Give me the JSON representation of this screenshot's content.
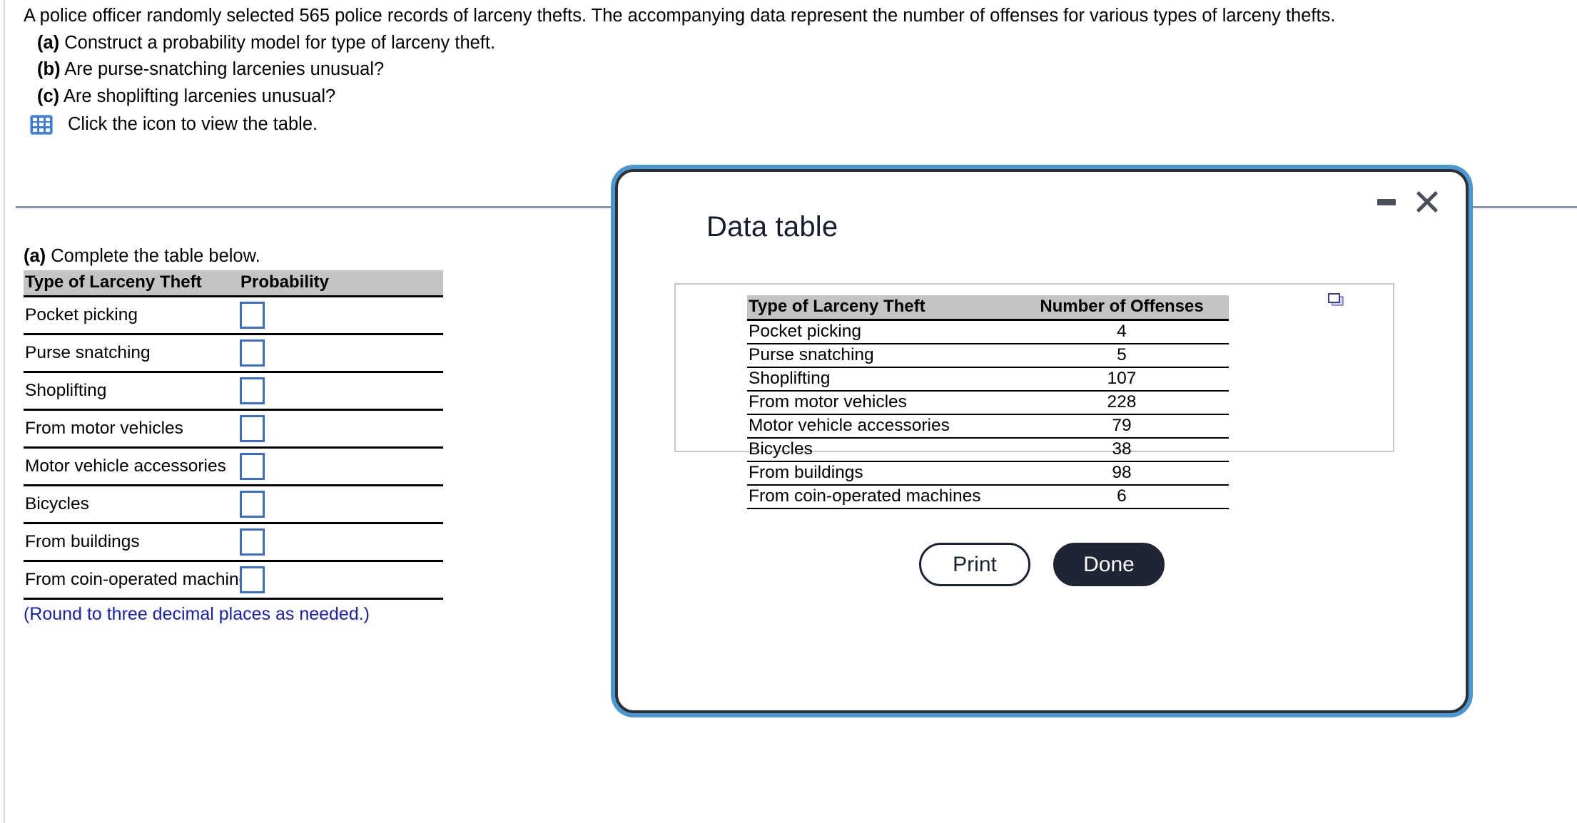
{
  "problem": {
    "intro": "A police officer randomly selected 565 police records of larceny thefts. The accompanying data represent the number of offenses for various types of larceny thefts.",
    "parts": [
      {
        "label": "(a)",
        "text": "Construct a probability model for type of larceny theft."
      },
      {
        "label": "(b)",
        "text": "Are purse-snatching larcenies unusual?"
      },
      {
        "label": "(c)",
        "text": "Are shoplifting larcenies unusual?"
      }
    ],
    "icon_line": {
      "icon": "table-grid-icon",
      "text": "Click the icon to view the table."
    }
  },
  "answer_section": {
    "heading_label": "(a)",
    "heading_text": "Complete the table below.",
    "columns": [
      "Type of Larceny Theft",
      "Probability"
    ],
    "rows": [
      {
        "type": "Pocket picking",
        "probability": ""
      },
      {
        "type": "Purse snatching",
        "probability": ""
      },
      {
        "type": "Shoplifting",
        "probability": ""
      },
      {
        "type": "From motor vehicles",
        "probability": ""
      },
      {
        "type": "Motor vehicle accessories",
        "probability": ""
      },
      {
        "type": "Bicycles",
        "probability": ""
      },
      {
        "type": "From buildings",
        "probability": ""
      },
      {
        "type": "From coin-operated machines",
        "probability": ""
      }
    ],
    "round_note": "(Round to three decimal places as needed.)",
    "input_border_color": "#3b6fc4",
    "header_bg_color": "#c4c4c4",
    "note_color": "#1a21b0"
  },
  "dialog": {
    "title": "Data table",
    "window_controls": {
      "minimize": "minimize-icon",
      "close": "close-icon"
    },
    "copy_icon": "copy-icon",
    "border_color": "#4a97d2",
    "table": {
      "columns": [
        "Type of Larceny Theft",
        "Number of Offenses"
      ],
      "rows": [
        {
          "type": "Pocket picking",
          "offenses": "4"
        },
        {
          "type": "Purse snatching",
          "offenses": "5"
        },
        {
          "type": "Shoplifting",
          "offenses": "107"
        },
        {
          "type": "From motor vehicles",
          "offenses": "228"
        },
        {
          "type": "Motor vehicle accessories",
          "offenses": "79"
        },
        {
          "type": "Bicycles",
          "offenses": "38"
        },
        {
          "type": "From buildings",
          "offenses": "98"
        },
        {
          "type": "From coin-operated machines",
          "offenses": "6"
        }
      ]
    },
    "buttons": {
      "print": "Print",
      "done": "Done"
    }
  }
}
